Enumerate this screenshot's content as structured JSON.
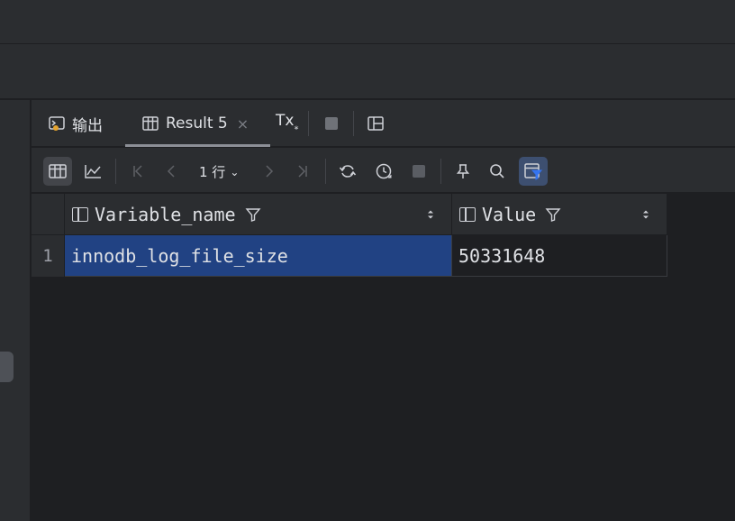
{
  "tabs": {
    "output_label": "输出",
    "result_label": "Result 5",
    "result_close": "×",
    "tx_label": "Tx",
    "tx_sub": "⁎"
  },
  "toolbar": {
    "rows_value": "1 行",
    "rows_chevron": "⌄"
  },
  "grid": {
    "columns": [
      {
        "name": "Variable_name"
      },
      {
        "name": "Value"
      }
    ],
    "rows": [
      {
        "num": "1",
        "cells": [
          "innodb_log_file_size",
          "50331648"
        ]
      }
    ]
  },
  "colors": {
    "selection": "#214283",
    "panel": "#2b2d30",
    "background": "#1e1f22"
  }
}
